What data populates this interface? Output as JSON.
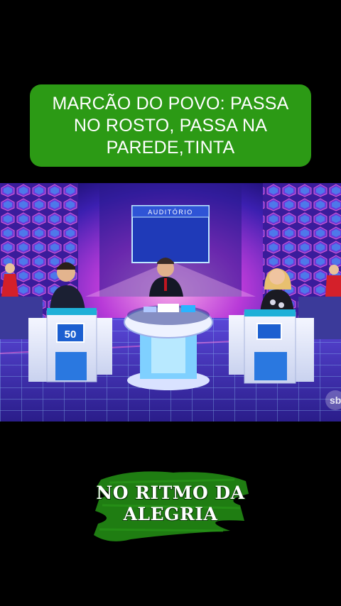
{
  "caption": {
    "text": "MARCÃO DO POVO: PASSA NO ROSTO, PASSA NA PAREDE,TINTA"
  },
  "video": {
    "screen_label": "AUDITÓRIO",
    "score_left": "50",
    "channel_logo_text": "sb"
  },
  "overlay": {
    "line1": "NO RITMO DA",
    "line2": "ALEGRIA"
  },
  "colors": {
    "caption_bg": "#2c9a15",
    "brush_green": "#1f7d12",
    "stage_blue": "#3a2cc8",
    "stage_pink": "#e0309a"
  }
}
